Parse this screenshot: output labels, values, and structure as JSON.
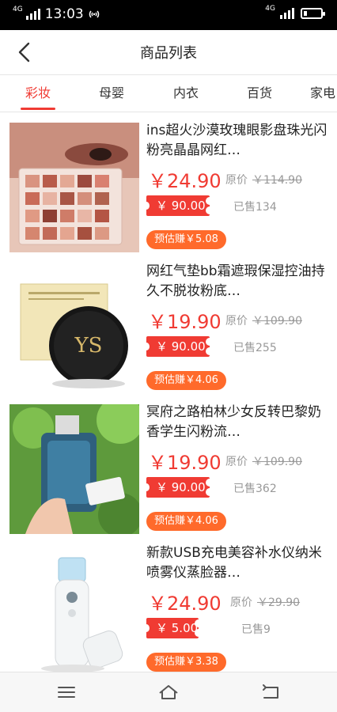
{
  "status": {
    "time": "13:03",
    "net_left": "4G",
    "net_right": "4G"
  },
  "nav": {
    "title": "商品列表"
  },
  "tabs": [
    {
      "label": "彩妆",
      "active": true
    },
    {
      "label": "母婴",
      "active": false
    },
    {
      "label": "内衣",
      "active": false
    },
    {
      "label": "百货",
      "active": false
    },
    {
      "label": "家电",
      "active": false
    }
  ],
  "products": [
    {
      "name": "ins超火沙漠玫瑰眼影盘珠光闪粉亮晶晶网红…",
      "price": "￥24.90",
      "orig_label": "原价",
      "orig_price": "￥114.90",
      "coupon": "￥ 90.00",
      "sold": "已售134",
      "earn": "预估赚￥5.08"
    },
    {
      "name": "网红气垫bb霜遮瑕保湿控油持久不脱妆粉底…",
      "price": "￥19.90",
      "orig_label": "原价",
      "orig_price": "￥109.90",
      "coupon": "￥ 90.00",
      "sold": "已售255",
      "earn": "预估赚￥4.06"
    },
    {
      "name": "冥府之路柏林少女反转巴黎奶香学生闪粉流…",
      "price": "￥19.90",
      "orig_label": "原价",
      "orig_price": "￥109.90",
      "coupon": "￥ 90.00",
      "sold": "已售362",
      "earn": "预估赚￥4.06"
    },
    {
      "name": "新款USB充电美容补水仪纳米喷雾仪蒸脸器…",
      "price": "￥24.90",
      "orig_label": "原价",
      "orig_price": "￥29.90",
      "coupon": "￥ 5.00",
      "sold": "已售9",
      "earn": "预估赚￥3.38"
    }
  ],
  "colors": {
    "accent": "#f03b33",
    "earn_badge": "#ff6a2b"
  },
  "icons": {
    "back": "chevron-left-icon",
    "menu": "menu-icon",
    "home": "home-icon",
    "return": "return-icon"
  }
}
